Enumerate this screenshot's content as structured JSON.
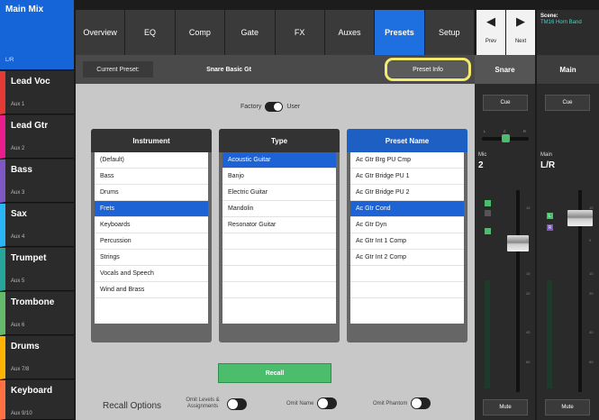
{
  "mixes": {
    "main": {
      "name": "Main Mix",
      "sub": "L/R"
    },
    "items": [
      {
        "name": "Lead Voc",
        "sub": "Aux 1",
        "color": "#e53935"
      },
      {
        "name": "Lead Gtr",
        "sub": "Aux 2",
        "color": "#e91e8c"
      },
      {
        "name": "Bass",
        "sub": "Aux 3",
        "color": "#7e57c2"
      },
      {
        "name": "Sax",
        "sub": "Aux 4",
        "color": "#29b6f6"
      },
      {
        "name": "Trumpet",
        "sub": "Aux 5",
        "color": "#26a69a"
      },
      {
        "name": "Trombone",
        "sub": "Aux 6",
        "color": "#66bb6a"
      },
      {
        "name": "Drums",
        "sub": "Aux 7/8",
        "color": "#ffb300"
      },
      {
        "name": "Keyboard",
        "sub": "Aux 9/10",
        "color": "#ff7043"
      }
    ]
  },
  "tabs": [
    "Overview",
    "EQ",
    "Comp",
    "Gate",
    "FX",
    "Auxes",
    "Presets",
    "Setup"
  ],
  "active_tab": "Presets",
  "nav": {
    "prev": "Prev",
    "next": "Next"
  },
  "scene": {
    "label": "Scene:",
    "name": "TM16 Horn Band"
  },
  "preset_bar": {
    "current_label": "Current Preset:",
    "current_value": "Snare Basic Gt",
    "info_button": "Preset Info"
  },
  "source_toggle": {
    "left": "Factory",
    "right": "User"
  },
  "columns": {
    "instrument": {
      "title": "Instrument",
      "items": [
        "(Default)",
        "Bass",
        "Drums",
        "Frets",
        "Keyboards",
        "Percussion",
        "Strings",
        "Vocals and Speech",
        "Wind and Brass"
      ],
      "selected": "Frets"
    },
    "type": {
      "title": "Type",
      "items": [
        "Acoustic Guitar",
        "Banjo",
        "Electric Guitar",
        "Mandolin",
        "Resonator Guitar"
      ],
      "selected": "Acoustic Guitar"
    },
    "preset": {
      "title": "Preset Name",
      "items": [
        "Ac Gtr Brg PU Cmp",
        "Ac Gtr Bridge PU 1",
        "Ac Gtr Bridge PU 2",
        "Ac Gtr Cond",
        "Ac Gtr Dyn",
        "Ac Gtr Int 1 Comp",
        "Ac Gtr Int 2 Comp"
      ],
      "selected": "Ac Gtr Cond"
    }
  },
  "recall": {
    "button": "Recall",
    "options_label": "Recall Options",
    "omit_levels": "Omit Levels & Assignments",
    "omit_name": "Omit Name",
    "omit_phantom": "Omit Phantom"
  },
  "strip_snare": {
    "title": "Snare",
    "cue": "Cue",
    "type": "Mic",
    "channel": "2",
    "pan": {
      "l": "L",
      "c": "C",
      "r": "R"
    },
    "scale": [
      "10",
      "0",
      "10",
      "20",
      "40",
      "60"
    ],
    "mute": "Mute"
  },
  "strip_main": {
    "title": "Main",
    "cue": "Cue",
    "type": "Main",
    "channel": "L/R",
    "scale": [
      "10",
      "0",
      "10",
      "20",
      "40",
      "60"
    ],
    "leds": {
      "l": "L",
      "r": "R"
    },
    "mute": "Mute"
  },
  "colors": {
    "accent": "#1e6fe0",
    "recall": "#4cbd6d",
    "highlight": "#f4ea6d"
  }
}
